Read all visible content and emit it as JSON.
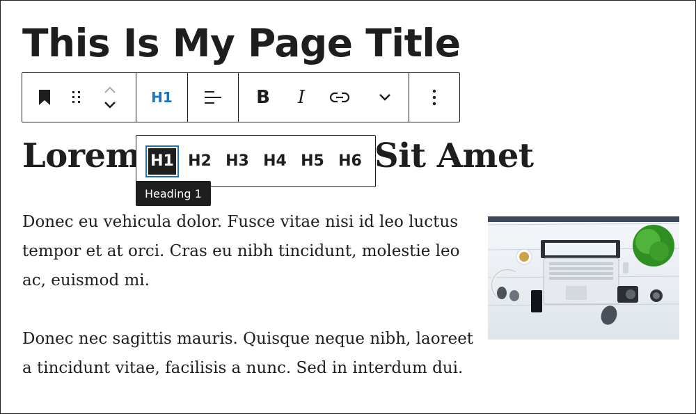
{
  "page_title": "This Is My Page Title",
  "toolbar": {
    "block_type_icon": "bookmark-icon",
    "drag_icon": "drag-handle-icon",
    "move_up_icon": "chevron-up-icon",
    "move_down_icon": "chevron-down-icon",
    "heading_level_label": "H1",
    "align_icon": "align-left-icon",
    "bold_label": "B",
    "italic_label": "I",
    "link_icon": "link-icon",
    "more_formats_icon": "chevron-down-icon",
    "options_icon": "more-vertical-icon",
    "accent_color": "#1e73be"
  },
  "heading": {
    "text_left": "Lorem",
    "text_right": "Sit Amet"
  },
  "level_menu": {
    "levels": [
      "H1",
      "H2",
      "H3",
      "H4",
      "H5",
      "H6"
    ],
    "selected": "H1"
  },
  "tooltip": {
    "text": "Heading 1"
  },
  "paragraphs": [
    "Donec eu vehicula dolor. Fusce vitae nisi id leo luctus tempor et at orci. Cras eu nibh tincidunt, molestie leo ac, euismod mi.",
    "Donec nec sagittis mauris. Quisque neque nibh, laoreet a tincidunt vitae, facilisis a nunc. Sed in interdum dui."
  ],
  "image": {
    "icon": "desk-photo-image"
  }
}
